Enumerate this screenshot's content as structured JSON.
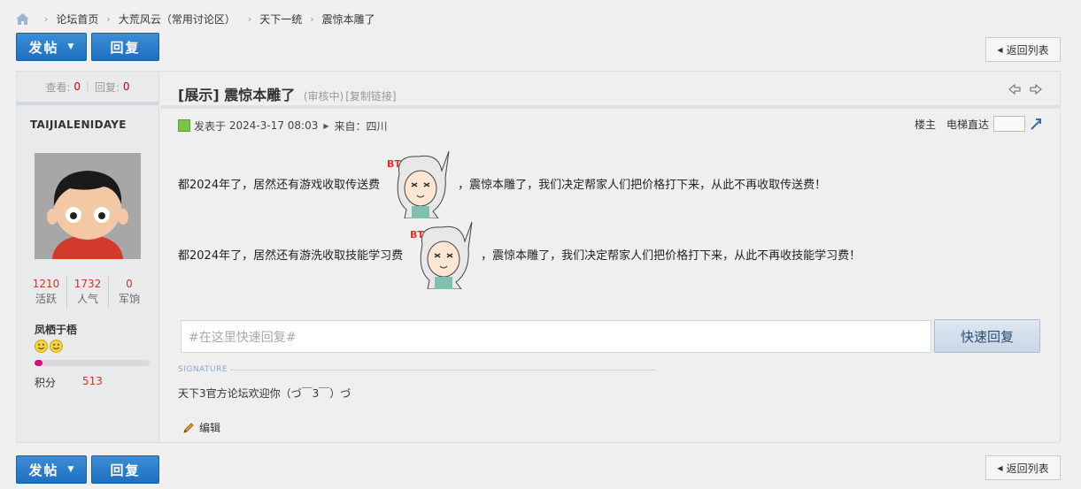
{
  "breadcrumb": {
    "home_icon": "home-icon",
    "items": [
      "论坛首页",
      "大荒风云（常用讨论区）",
      "天下一统",
      "震惊本雕了"
    ]
  },
  "toolbar": {
    "post_label": "发帖",
    "reply_label": "回复",
    "back_label": "返回列表"
  },
  "sidebar": {
    "views_label": "查看:",
    "views": "0",
    "replies_label": "回复:",
    "replies": "0",
    "author": "TAIJIALENIDAYE",
    "stats": [
      {
        "value": "1210",
        "label": "活跃"
      },
      {
        "value": "1732",
        "label": "人气"
      },
      {
        "value": "0",
        "label": "军饷"
      }
    ],
    "group": "凤栖于梧",
    "level_progress": 0.07,
    "points_label": "积分",
    "points": "513"
  },
  "post": {
    "tag": "[展示]",
    "title": "震惊本雕了",
    "status": "(审核中)",
    "copy_link": "[复制链接]",
    "posted_label": "发表于",
    "posted_time": "2024-3-17 08:03",
    "source_label": "来自：",
    "source": "四川",
    "floor_label": "楼主",
    "elevator_label": "电梯直达",
    "para1_before": "都2024年了，居然还有游戏收取传送费",
    "para1_after": "，震惊本雕了，我们决定帮家人们把价格打下来，从此不再收取传送费！",
    "para2_before": "都2024年了，居然还有游洗收取技能学习费",
    "para2_after": "，震惊本雕了，我们决定帮家人们把价格打下来，从此不再收技能学习费！",
    "sticker_text": "BTE"
  },
  "quick_reply": {
    "placeholder": "#在这里快速回复#",
    "button_label": "快速回复"
  },
  "signature": {
    "label": "SIGNATURE",
    "text": "天下3官方论坛欢迎你（づ￣3￣）づ"
  },
  "edit_label": "编辑",
  "colors": {
    "primary_button": "#2a7ccb",
    "accent_red": "#c0392b",
    "progress_fill": "#e4007f"
  }
}
